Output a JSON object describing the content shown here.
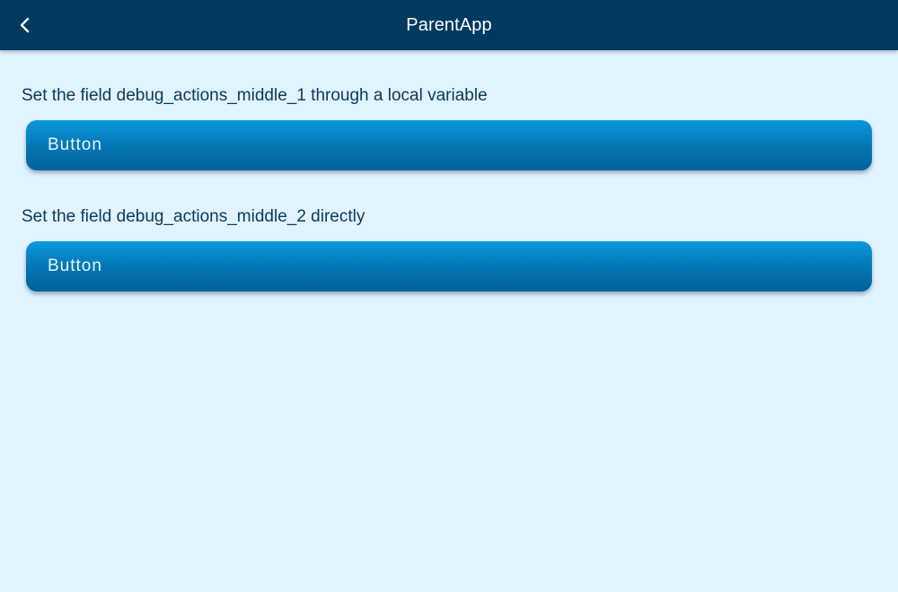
{
  "header": {
    "title": "ParentApp",
    "back_icon": "chevron-left-icon"
  },
  "colors": {
    "app_bar": "#003a61",
    "background": "#e0f3fe",
    "button_top": "#0b98de",
    "button_bottom": "#02639a",
    "label_text": "#0b3a5a"
  },
  "sections": [
    {
      "label": "Set the field debug_actions_middle_1 through a local variable",
      "button_label": "Button"
    },
    {
      "label": "Set the field debug_actions_middle_2 directly",
      "button_label": "Button"
    }
  ]
}
